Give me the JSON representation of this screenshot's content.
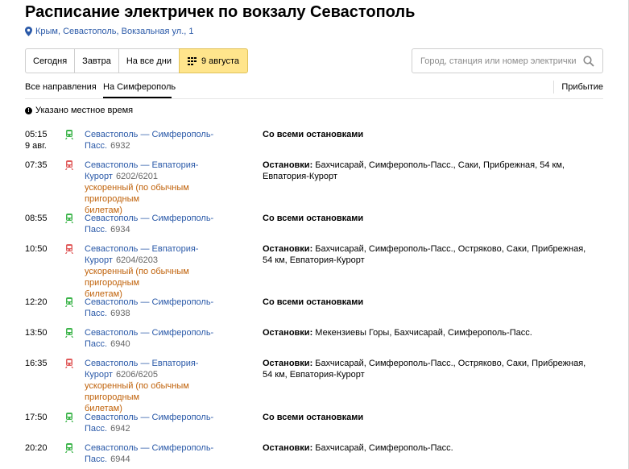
{
  "page": {
    "title": "Расписание электричек по вокзалу Севастополь",
    "address": "Крым, Севастополь, Вокзальная ул., 1"
  },
  "days": {
    "today": "Сегодня",
    "tomorrow": "Завтра",
    "all_days": "На все дни",
    "selected": "9 августа"
  },
  "search": {
    "placeholder": "Город, станция или номер электрички"
  },
  "tabs": {
    "all": "Все направления",
    "simferopol": "На Симферополь",
    "arrival": "Прибытие"
  },
  "note": "Указано местное время",
  "colors": {
    "link": "#2a59a8",
    "express": "#c0620a",
    "regular_icon": "#3cb44a",
    "express_icon": "#e05a5a",
    "active_day": "#ffe58c"
  },
  "rows": [
    {
      "time": "05:15",
      "date": "9 авг.",
      "icon": "train-regular-icon",
      "route_l1": "Севастополь — Симферополь-",
      "route_l2": "Пасс.",
      "number": "6932",
      "express": "",
      "express_l2": "",
      "stops_label": "Со всеми остановками",
      "stops_text": ""
    },
    {
      "time": "07:35",
      "date": "",
      "icon": "train-express-icon",
      "route_l1": "Севастополь — Евпатория-",
      "route_l2": "Курорт",
      "number": "6202/6201",
      "express": "ускоренный (по обычным пригородным",
      "express_l2": "билетам)",
      "stops_label": "Остановки:",
      "stops_text": " Бахчисарай, Симферополь-Пасс., Саки, Прибрежная, 54 км, Евпатория-Курорт"
    },
    {
      "time": "08:55",
      "date": "",
      "icon": "train-regular-icon",
      "route_l1": "Севастополь — Симферополь-",
      "route_l2": "Пасс.",
      "number": "6934",
      "express": "",
      "express_l2": "",
      "stops_label": "Со всеми остановками",
      "stops_text": ""
    },
    {
      "time": "10:50",
      "date": "",
      "icon": "train-express-icon",
      "route_l1": "Севастополь — Евпатория-",
      "route_l2": "Курорт",
      "number": "6204/6203",
      "express": "ускоренный (по обычным пригородным",
      "express_l2": "билетам)",
      "stops_label": "Остановки:",
      "stops_text": " Бахчисарай, Симферополь-Пасс., Остряково, Саки, Прибрежная, 54 км, Евпатория-Курорт"
    },
    {
      "time": "12:20",
      "date": "",
      "icon": "train-regular-icon",
      "route_l1": "Севастополь — Симферополь-",
      "route_l2": "Пасс.",
      "number": "6938",
      "express": "",
      "express_l2": "",
      "stops_label": "Со всеми остановками",
      "stops_text": ""
    },
    {
      "time": "13:50",
      "date": "",
      "icon": "train-regular-icon",
      "route_l1": "Севастополь — Симферополь-",
      "route_l2": "Пасс.",
      "number": "6940",
      "express": "",
      "express_l2": "",
      "stops_label": "Остановки:",
      "stops_text": " Мекензиевы Горы, Бахчисарай, Симферополь-Пасс."
    },
    {
      "time": "16:35",
      "date": "",
      "icon": "train-express-icon",
      "route_l1": "Севастополь — Евпатория-",
      "route_l2": "Курорт",
      "number": "6206/6205",
      "express": "ускоренный (по обычным пригородным",
      "express_l2": "билетам)",
      "stops_label": "Остановки:",
      "stops_text": " Бахчисарай, Симферополь-Пасс., Остряково, Саки, Прибрежная, 54 км, Евпатория-Курорт"
    },
    {
      "time": "17:50",
      "date": "",
      "icon": "train-regular-icon",
      "route_l1": "Севастополь — Симферополь-",
      "route_l2": "Пасс.",
      "number": "6942",
      "express": "",
      "express_l2": "",
      "stops_label": "Со всеми остановками",
      "stops_text": ""
    },
    {
      "time": "20:20",
      "date": "",
      "icon": "train-regular-icon",
      "route_l1": "Севастополь — Симферополь-",
      "route_l2": "Пасс.",
      "number": "6944",
      "express": "",
      "express_l2": "",
      "stops_label": "Остановки:",
      "stops_text": " Бахчисарай, Симферополь-Пасс."
    }
  ]
}
